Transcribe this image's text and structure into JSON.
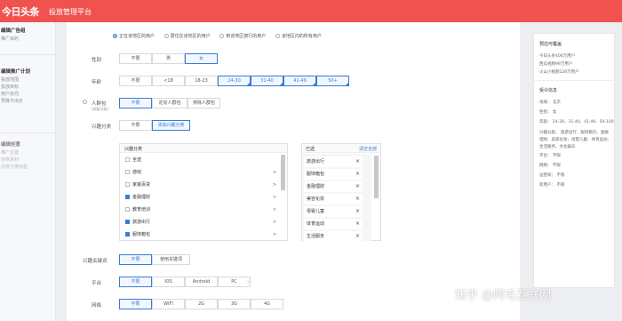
{
  "header": {
    "logo": "今日头条",
    "platform": "投放管理平台"
  },
  "sidebar": {
    "group1": {
      "title": "编辑广告组",
      "items": [
        "推广目的"
      ]
    },
    "group2": {
      "title": "编辑推广计划",
      "items": [
        "投放范围",
        "投放目标",
        "用户定向",
        "预算与出价"
      ]
    },
    "group3": {
      "title": "编辑创意",
      "items": [
        "推广位置",
        "创意素材",
        "创意分类标签"
      ]
    }
  },
  "location": {
    "options": [
      "正在该地区的用户",
      "居住在该地区的用户",
      "到该地区旅行的用户",
      "该地区内的所有用户"
    ]
  },
  "gender": {
    "label": "性别",
    "options": [
      "不限",
      "男",
      "女"
    ]
  },
  "age": {
    "label": "年龄",
    "options": [
      "不限",
      "<18",
      "18-23",
      "24-30",
      "31-40",
      "41-49",
      "50+"
    ]
  },
  "audience": {
    "label": "人群包",
    "sublabel": "(高级功能)",
    "options": [
      "不限",
      "定向人群包",
      "排除人群包"
    ]
  },
  "interest": {
    "label": "兴趣分类",
    "options": [
      "不限",
      "添加兴趣分类"
    ],
    "list_header": "兴趣分类",
    "items": [
      {
        "label": "全选",
        "checked": false,
        "arrow": ""
      },
      {
        "label": "游戏",
        "checked": false,
        "arrow": ">"
      },
      {
        "label": "家装百货",
        "checked": false,
        "arrow": ">"
      },
      {
        "label": "金融理财",
        "checked": true,
        "arrow": ">"
      },
      {
        "label": "教育培训",
        "checked": false,
        "arrow": ">"
      },
      {
        "label": "旅游出行",
        "checked": true,
        "arrow": ">"
      },
      {
        "label": "服饰箱包",
        "checked": true,
        "arrow": ">"
      }
    ],
    "selected_header": "已选",
    "clear_all": "清空全部",
    "selected": [
      "旅游出行",
      "服饰箱包",
      "金融理财",
      "美容化妆",
      "母婴儿童",
      "体育运动",
      "生活服务"
    ],
    "remove_glyph": "×"
  },
  "keywords": {
    "label": "兴趣关键词",
    "options": [
      "不限",
      "使用关键词"
    ]
  },
  "platform": {
    "label": "平台",
    "options": [
      "不限",
      "IOS",
      "Android",
      "PC"
    ]
  },
  "network": {
    "label": "网络",
    "options": [
      "不限",
      "WIFI",
      "2G",
      "3G",
      "4G"
    ]
  },
  "right_panel": {
    "estimate_title": "预估可覆盖",
    "estimate_lines": [
      "今日头条406万用户",
      "西瓜视频99万用户",
      "火山小视频126万用户"
    ],
    "info_title": "受众信息",
    "info_lines": [
      "地域：  北京",
      "性别：  女",
      "年龄：  24-30、31-40、41-49、50-100",
      "兴趣分类： 旅游出行、服饰箱包、金融",
      "理财、美容化妆、母婴儿童、体育运动、",
      "生活服务、文化娱乐",
      "平台：  不限",
      "网络：  不限",
      "运营商：  不限",
      "新用户：  不限"
    ]
  },
  "watermark": "知乎 @阿毛互联网",
  "colors": {
    "header": "#f0534f",
    "accent": "#3a7bd5"
  }
}
